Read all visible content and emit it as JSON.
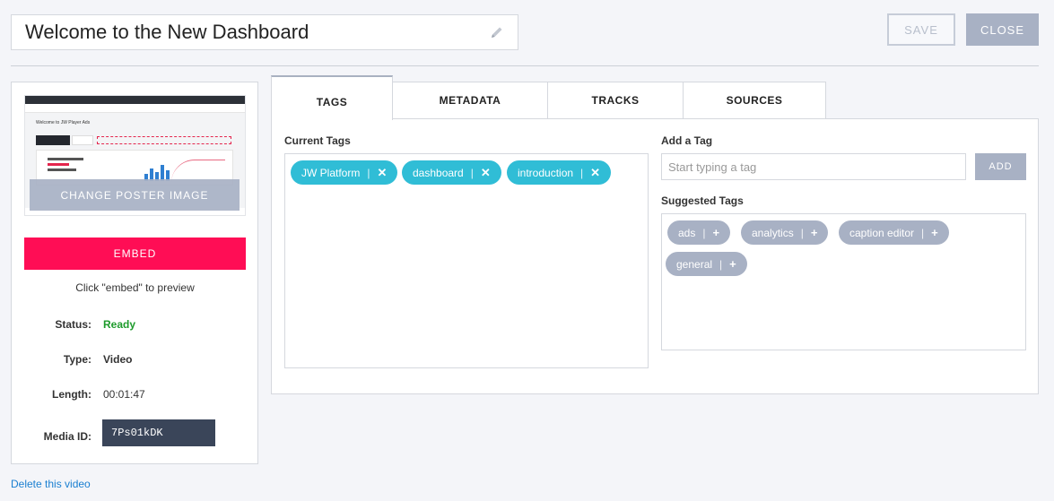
{
  "header": {
    "title": "Welcome to the New Dashboard",
    "save_label": "SAVE",
    "close_label": "CLOSE"
  },
  "sidebar": {
    "poster": {
      "heading": "Welcome to JW Player Ads"
    },
    "change_poster_label": "CHANGE POSTER IMAGE",
    "embed_label": "EMBED",
    "embed_hint": "Click \"embed\" to preview",
    "status_label": "Status:",
    "status_value": "Ready",
    "type_label": "Type:",
    "type_value": "Video",
    "length_label": "Length:",
    "length_value": "00:01:47",
    "media_id_label": "Media ID:",
    "media_id_value": "7Ps01kDK",
    "delete_label": "Delete this video"
  },
  "tabs": [
    {
      "label": "TAGS",
      "active": true
    },
    {
      "label": "METADATA",
      "active": false
    },
    {
      "label": "TRACKS",
      "active": false
    },
    {
      "label": "SOURCES",
      "active": false
    }
  ],
  "tags_panel": {
    "current_label": "Current Tags",
    "current_tags": [
      "JW Platform",
      "dashboard",
      "introduction"
    ],
    "remove_symbol": "✕",
    "separator": "|",
    "add_label": "Add a Tag",
    "add_placeholder": "Start typing a tag",
    "add_button": "ADD",
    "suggested_label": "Suggested Tags",
    "suggested_tags": [
      "ads",
      "analytics",
      "caption editor",
      "general"
    ],
    "add_symbol": "+"
  },
  "colors": {
    "accent_cyan": "#30bdd6",
    "embed_pink": "#ff0d55",
    "status_green": "#1e9b2c",
    "muted_button": "#a8b1c4",
    "link_blue": "#1a7fd1"
  },
  "icons": [
    "pencil-icon",
    "close-icon",
    "plus-icon"
  ]
}
